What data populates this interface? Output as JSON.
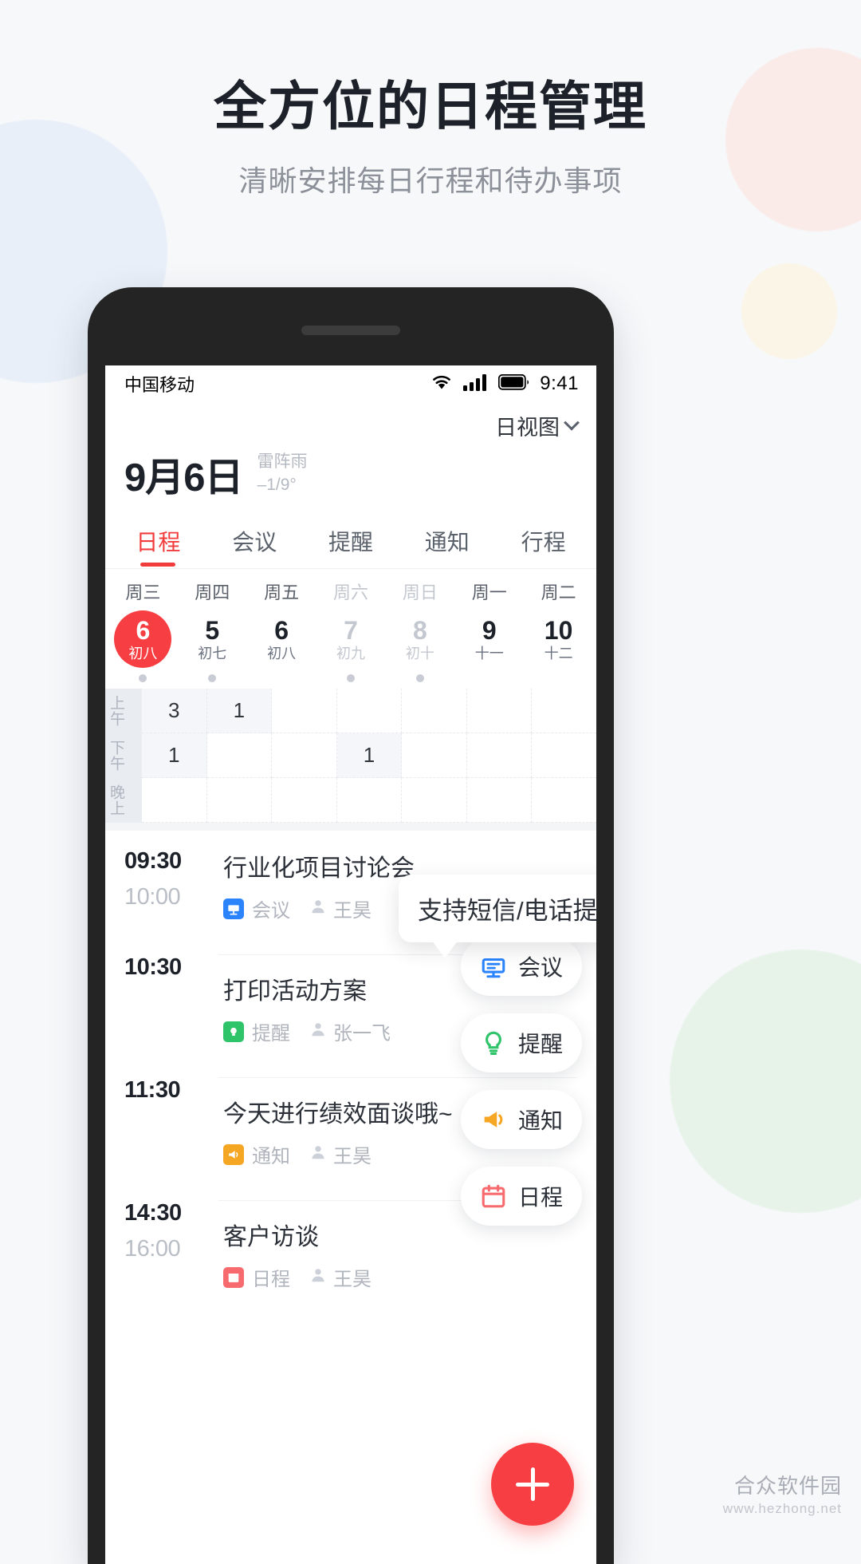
{
  "hero": {
    "title": "全方位的日程管理",
    "subtitle": "清晰安排每日行程和待办事项"
  },
  "status_bar": {
    "carrier": "中国移动",
    "time": "9:41",
    "icons": [
      "wifi-icon",
      "cellular-signal-icon",
      "battery-icon"
    ]
  },
  "header": {
    "view_mode": "日视图",
    "date": "9月6日",
    "weather_desc": "雷阵雨",
    "weather_temp": "–1/9°"
  },
  "tabs": [
    {
      "label": "日程",
      "active": true
    },
    {
      "label": "会议",
      "active": false
    },
    {
      "label": "提醒",
      "active": false
    },
    {
      "label": "通知",
      "active": false
    },
    {
      "label": "行程",
      "active": false
    }
  ],
  "week_days": [
    {
      "weekday": "周三",
      "day": "6",
      "lunar": "初八",
      "selected": true,
      "weekend": false,
      "dot": true
    },
    {
      "weekday": "周四",
      "day": "5",
      "lunar": "初七",
      "selected": false,
      "weekend": false,
      "dot": true
    },
    {
      "weekday": "周五",
      "day": "6",
      "lunar": "初八",
      "selected": false,
      "weekend": false,
      "dot": false
    },
    {
      "weekday": "周六",
      "day": "7",
      "lunar": "初九",
      "selected": false,
      "weekend": true,
      "dot": true
    },
    {
      "weekday": "周日",
      "day": "8",
      "lunar": "初十",
      "selected": false,
      "weekend": true,
      "dot": true
    },
    {
      "weekday": "周一",
      "day": "9",
      "lunar": "十一",
      "selected": false,
      "weekend": false,
      "dot": false
    },
    {
      "weekday": "周二",
      "day": "10",
      "lunar": "十二",
      "selected": false,
      "weekend": false,
      "dot": false
    }
  ],
  "time_grid": {
    "row_labels": [
      "上午",
      "下午",
      "晚上"
    ],
    "rows": [
      [
        "3",
        "1",
        "",
        "",
        "",
        "",
        ""
      ],
      [
        "1",
        "",
        "",
        "1",
        "",
        "",
        ""
      ],
      [
        "",
        "",
        "",
        "",
        "",
        "",
        ""
      ]
    ]
  },
  "schedule": [
    {
      "start": "09:30",
      "end": "10:00",
      "title": "行业化项目讨论会",
      "type": "会议",
      "type_icon": "meeting-icon",
      "type_color": "#2b84fc",
      "owner": "王昊"
    },
    {
      "start": "10:30",
      "end": "",
      "title": "打印活动方案",
      "type": "提醒",
      "type_icon": "bulb-icon",
      "type_color": "#2fc36a",
      "owner": "张一飞"
    },
    {
      "start": "11:30",
      "end": "",
      "title": "今天进行绩效面谈哦~",
      "type": "通知",
      "type_icon": "megaphone-icon",
      "type_color": "#f5a623",
      "owner": "王昊"
    },
    {
      "start": "14:30",
      "end": "16:00",
      "title": "客户访谈",
      "type": "日程",
      "type_icon": "calendar-icon",
      "type_color": "#f76a6e",
      "owner": "王昊"
    }
  ],
  "tooltip": {
    "text": "支持短信/电话提醒"
  },
  "type_chips": [
    {
      "label": "会议",
      "icon": "meeting-icon",
      "color": "#2b84fc"
    },
    {
      "label": "提醒",
      "icon": "bulb-icon",
      "color": "#2fc36a"
    },
    {
      "label": "通知",
      "icon": "megaphone-icon",
      "color": "#f5a623"
    },
    {
      "label": "日程",
      "icon": "calendar-icon",
      "color": "#f76a6e"
    }
  ],
  "fab": {
    "label": "add-icon",
    "color": "#f73f43"
  },
  "watermark": {
    "main": "合众软件园",
    "sub": "www.hezhong.net"
  },
  "theme": {
    "accent": "#f73f43",
    "text_primary": "#1d2129",
    "text_secondary": "#8b9099",
    "page_bg": "#f7f8fa"
  }
}
